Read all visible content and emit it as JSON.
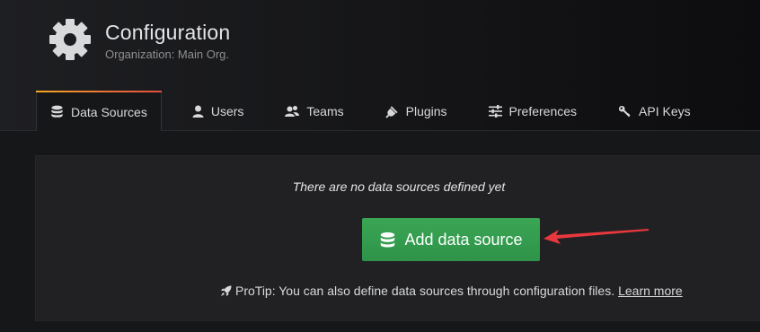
{
  "header": {
    "title": "Configuration",
    "subtitle": "Organization: Main Org.",
    "icon": "gear-icon"
  },
  "tabs": [
    {
      "label": "Data Sources",
      "icon": "database-icon",
      "active": true
    },
    {
      "label": "Users",
      "icon": "user-icon",
      "active": false
    },
    {
      "label": "Teams",
      "icon": "users-icon",
      "active": false
    },
    {
      "label": "Plugins",
      "icon": "plug-icon",
      "active": false
    },
    {
      "label": "Preferences",
      "icon": "sliders-icon",
      "active": false
    },
    {
      "label": "API Keys",
      "icon": "key-icon",
      "active": false
    }
  ],
  "empty_state": {
    "message": "There are no data sources defined yet",
    "button_label": "Add data source",
    "button_icon": "database-icon",
    "protip_text": "ProTip: You can also define data sources through configuration files.",
    "protip_icon": "rocket-icon",
    "link_text": "Learn more"
  },
  "colors": {
    "accent_gradient_start": "#f6a623",
    "accent_gradient_end": "#e24d42",
    "button_green": "#2e9348",
    "annotation_arrow": "#e8383d"
  }
}
